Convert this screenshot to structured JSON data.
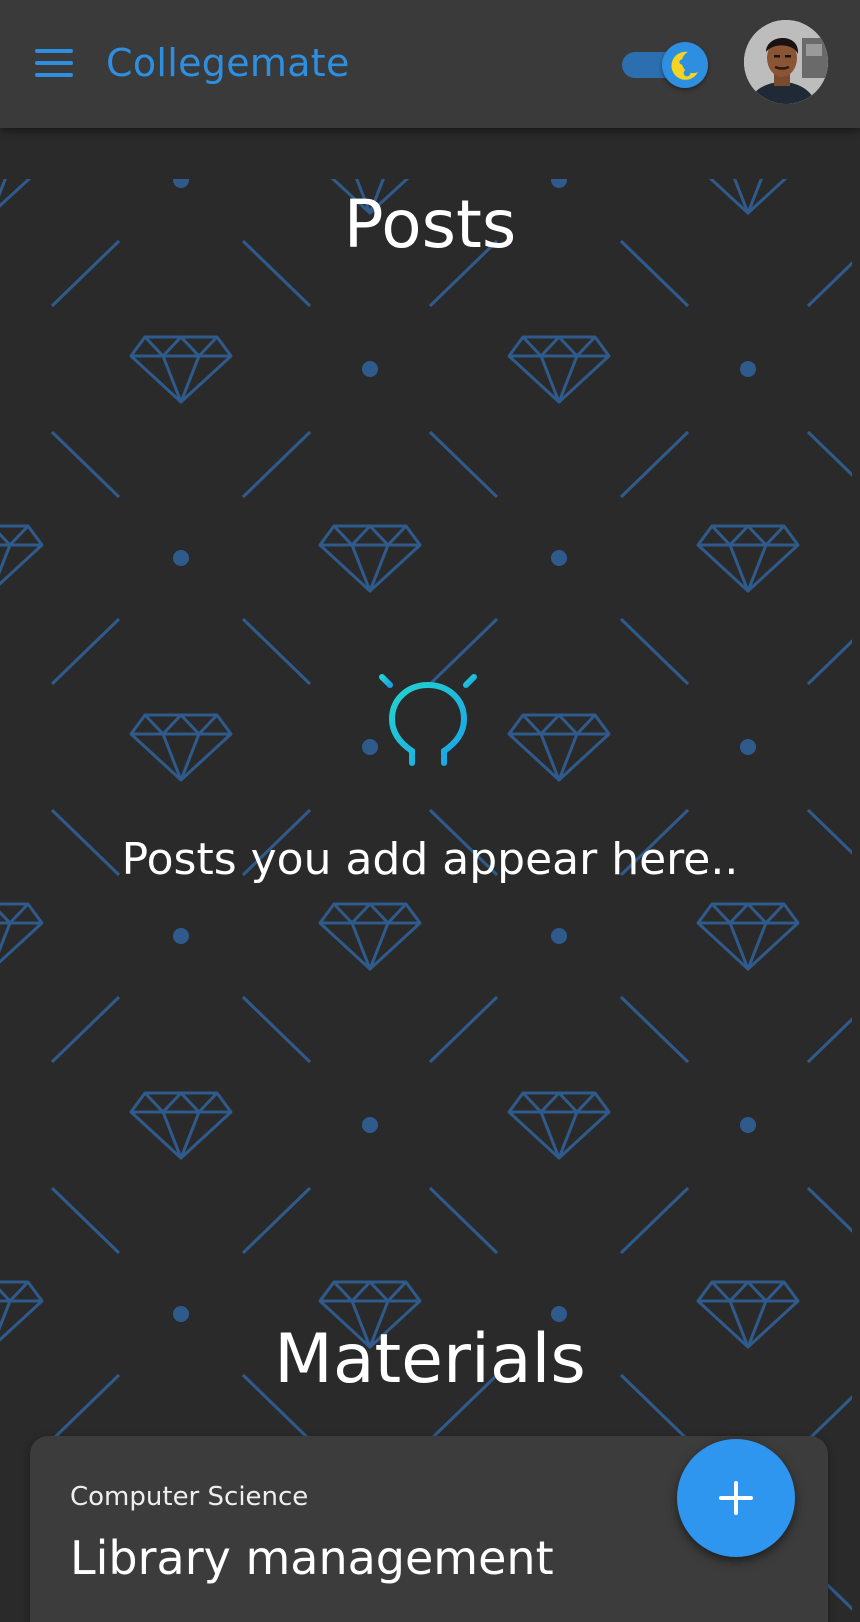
{
  "app_bar": {
    "title": "Collegemate",
    "menu_icon": "hamburger-menu-icon",
    "theme_toggle_icon": "moon-icon",
    "theme_toggle_state": "dark",
    "accent_color": "#2e8fe0"
  },
  "posts": {
    "title": "Posts",
    "empty_icon": "lightbulb-icon",
    "empty_message": "Posts you add appear here.."
  },
  "materials": {
    "title": "Materials",
    "items": [
      {
        "category": "Computer Science",
        "title": "Library management"
      }
    ]
  },
  "fab": {
    "icon": "plus-icon",
    "color": "#2e96ee"
  }
}
